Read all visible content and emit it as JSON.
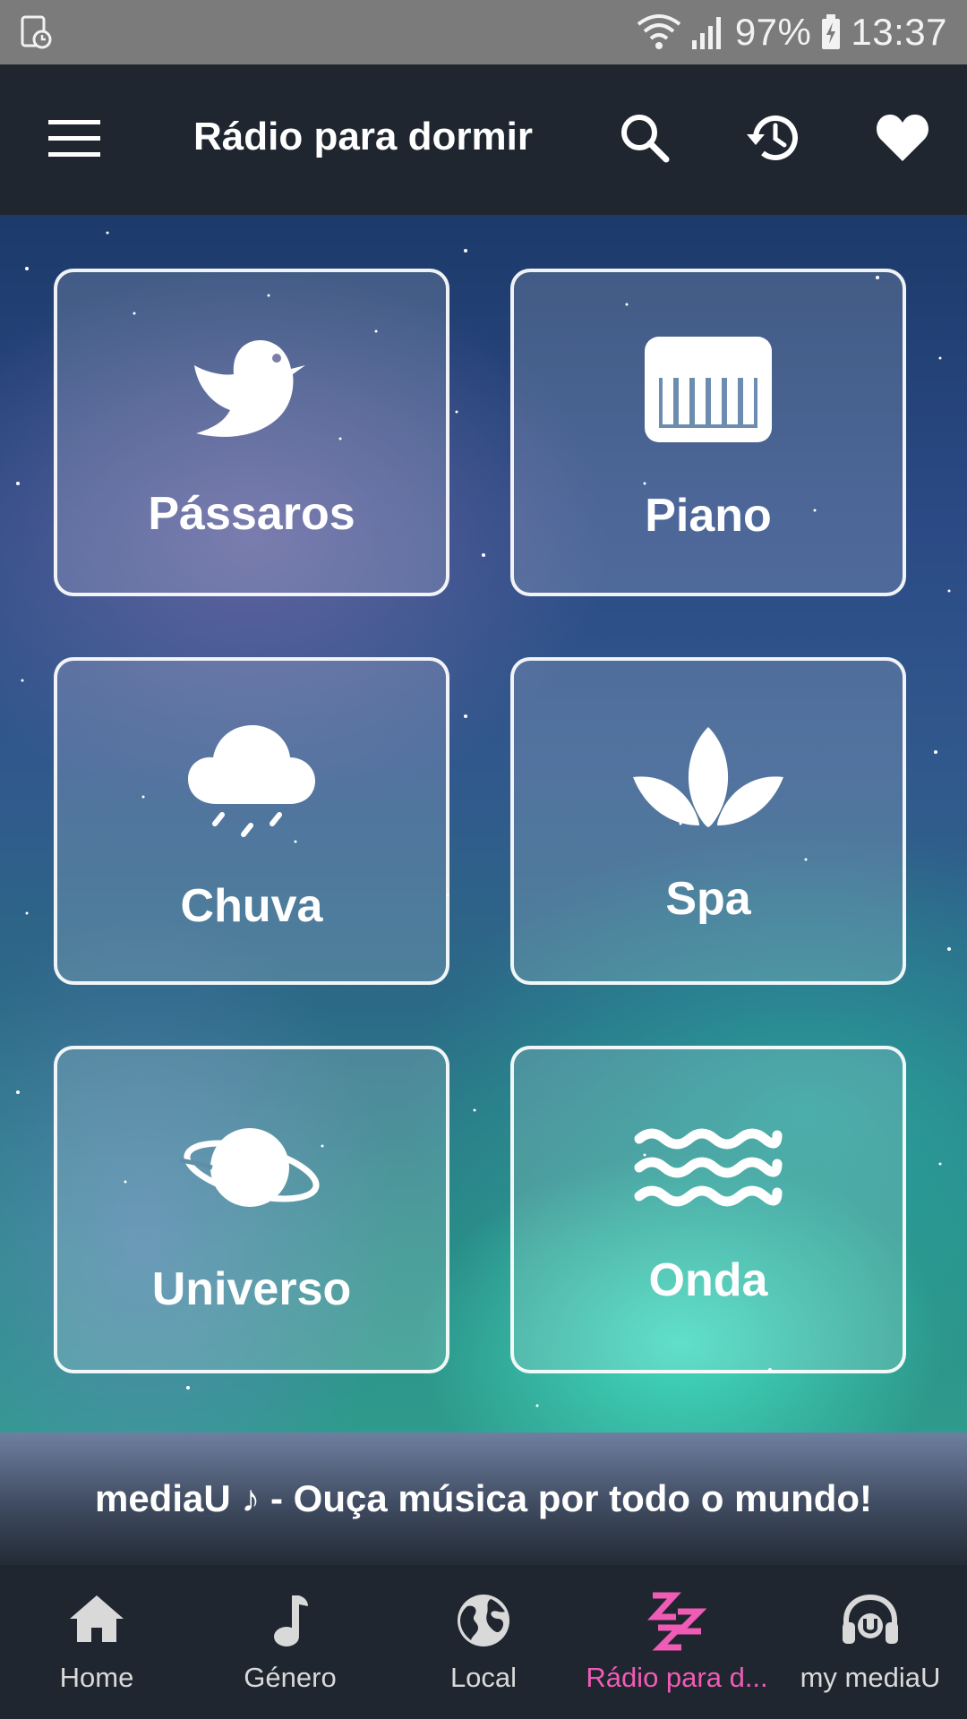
{
  "status_bar": {
    "wifi_icon": "wifi-icon",
    "signal_icon": "signal-icon",
    "battery": "97%",
    "battery_icon": "battery-charging-icon",
    "time": "13:37"
  },
  "app_bar": {
    "title": "Rádio para dormir",
    "actions": [
      "search-icon",
      "history-icon",
      "heart-icon"
    ]
  },
  "tiles": [
    {
      "label": "Pássaros",
      "icon": "bird-icon"
    },
    {
      "label": "Piano",
      "icon": "piano-icon"
    },
    {
      "label": "Chuva",
      "icon": "rain-cloud-icon"
    },
    {
      "label": "Spa",
      "icon": "lotus-icon"
    },
    {
      "label": "Universo",
      "icon": "planet-icon"
    },
    {
      "label": "Onda",
      "icon": "waves-icon"
    }
  ],
  "banner": {
    "text": "mediaU ♪ - Ouça música por todo o mundo!"
  },
  "bottom_nav": {
    "active_color": "#f05bb5",
    "items": [
      {
        "label": "Home",
        "icon": "home-icon"
      },
      {
        "label": "Género",
        "icon": "music-note-icon"
      },
      {
        "label": "Local",
        "icon": "globe-icon"
      },
      {
        "label": "Rádio para d...",
        "icon": "sleep-zzz-icon"
      },
      {
        "label": "my mediaU",
        "icon": "headphones-icon"
      }
    ]
  }
}
